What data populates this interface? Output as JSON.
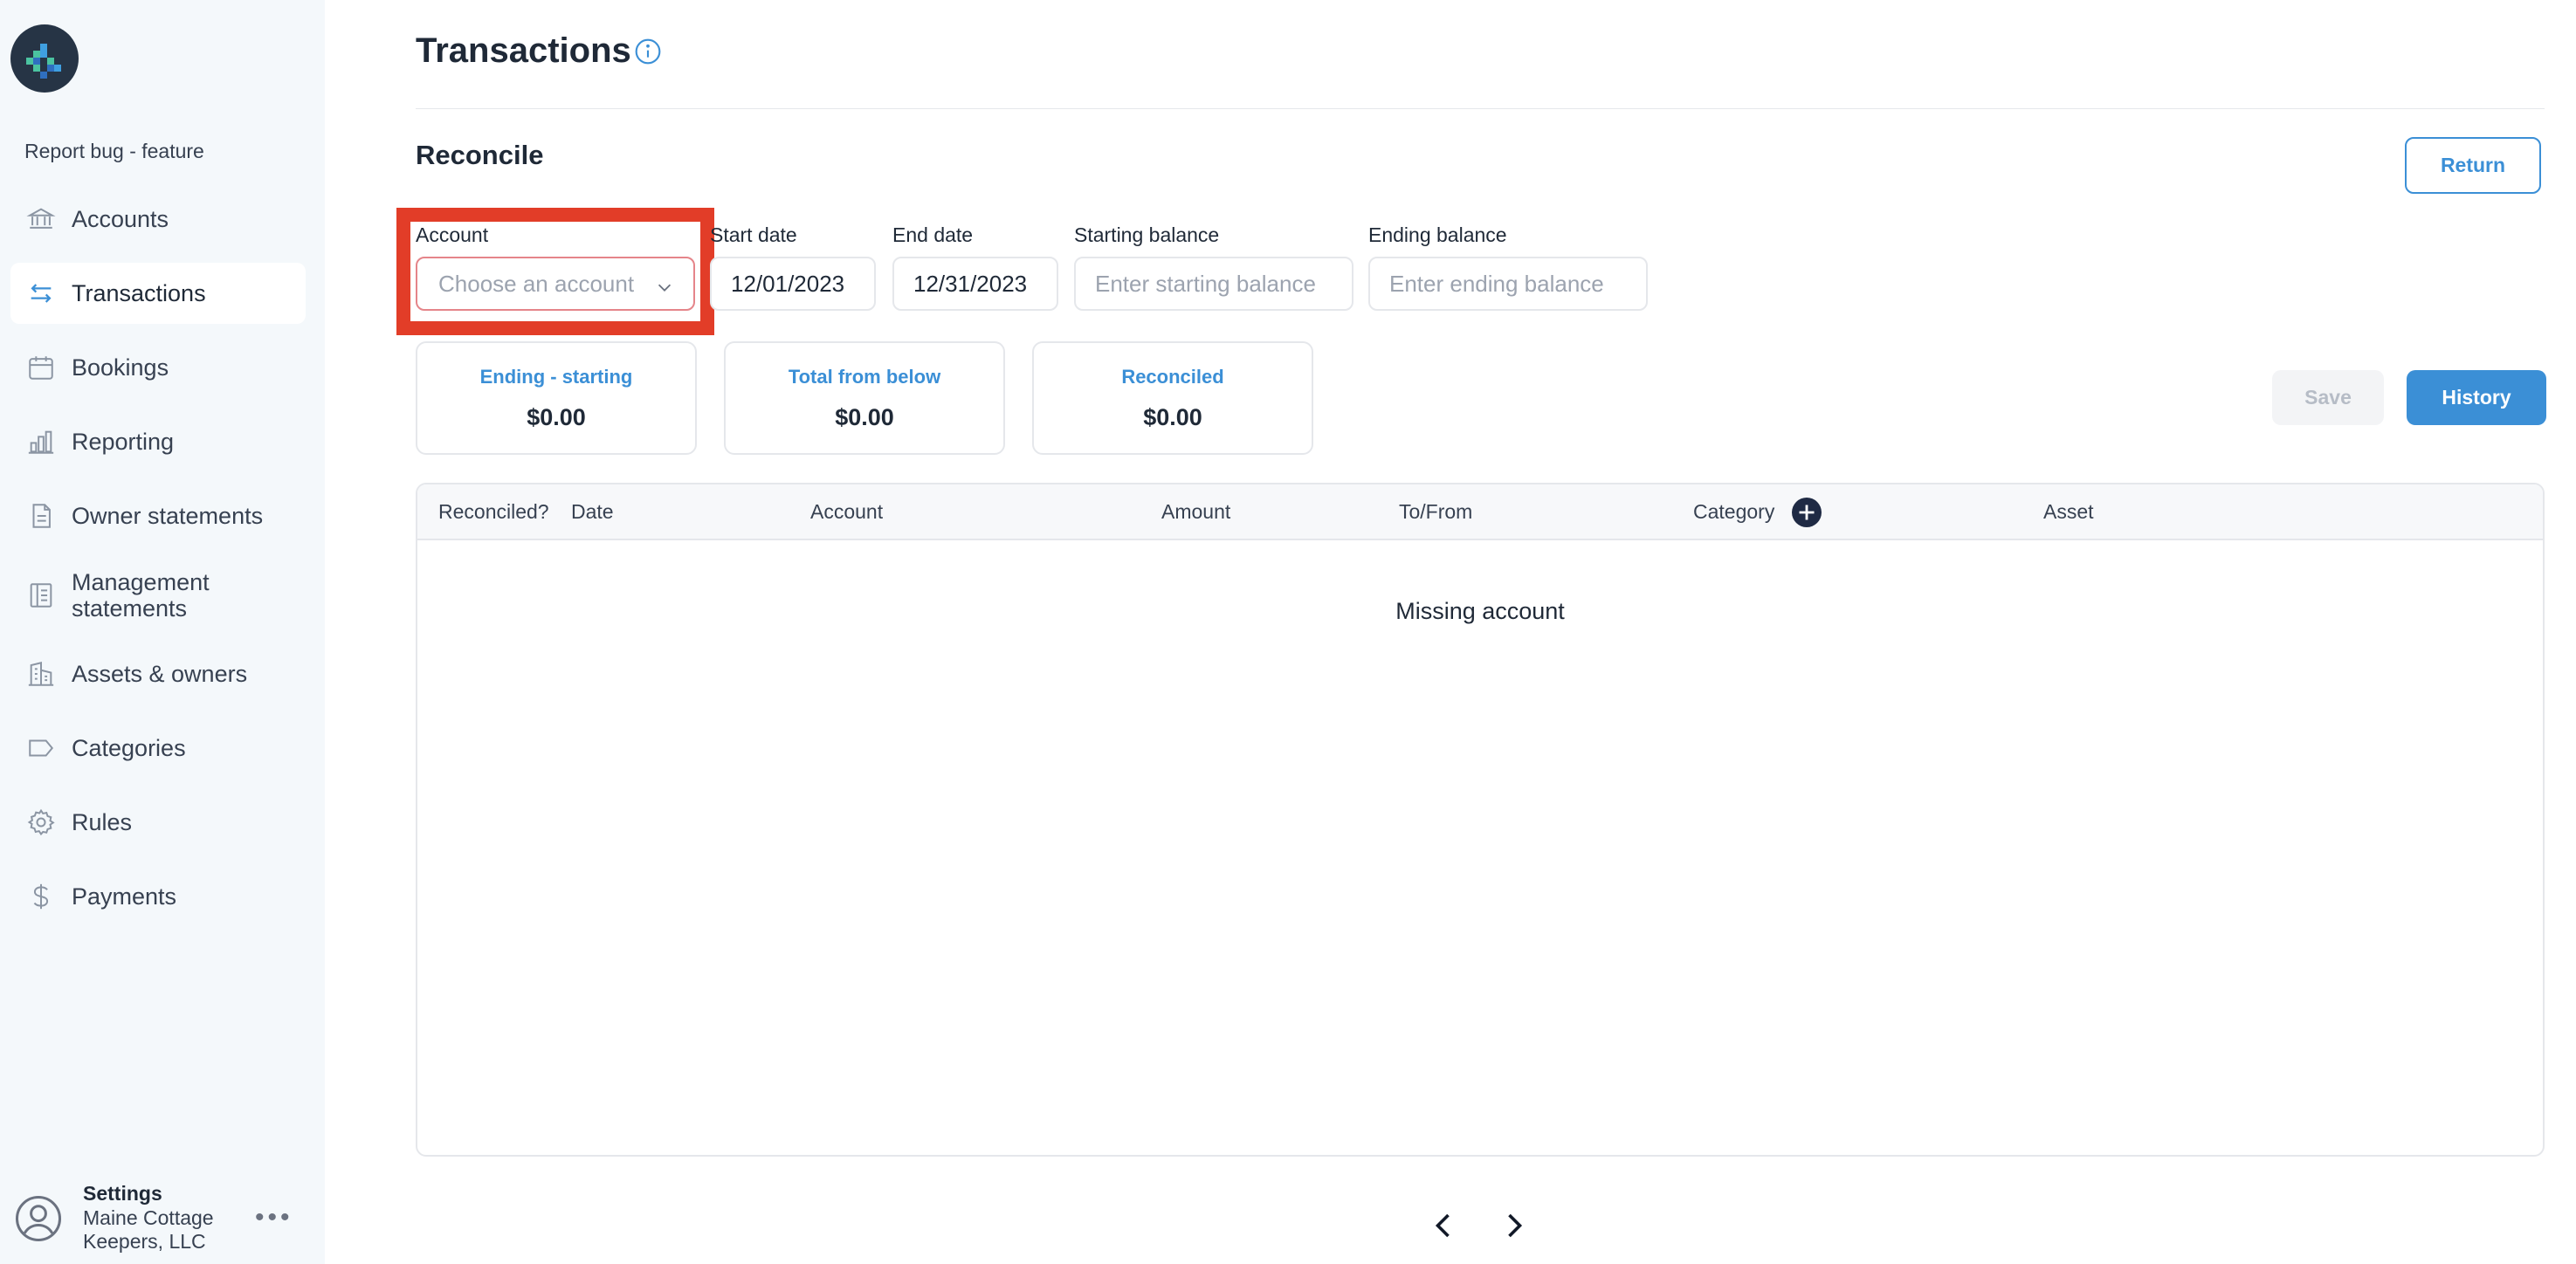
{
  "sidebar": {
    "report_bug": "Report bug - feature",
    "items": [
      {
        "label": "Accounts",
        "icon": "bank-icon",
        "active": false
      },
      {
        "label": "Transactions",
        "icon": "arrows-exchange-icon",
        "active": true
      },
      {
        "label": "Bookings",
        "icon": "calendar-icon",
        "active": false
      },
      {
        "label": "Reporting",
        "icon": "bar-chart-icon",
        "active": false
      },
      {
        "label": "Owner statements",
        "icon": "document-icon",
        "active": false
      },
      {
        "label": "Management statements",
        "icon": "statement-icon",
        "active": false
      },
      {
        "label": "Assets & owners",
        "icon": "building-icon",
        "active": false
      },
      {
        "label": "Categories",
        "icon": "tag-icon",
        "active": false
      },
      {
        "label": "Rules",
        "icon": "gear-icon",
        "active": false
      },
      {
        "label": "Payments",
        "icon": "dollar-icon",
        "active": false
      }
    ],
    "settings": {
      "title": "Settings",
      "org": "Maine Cottage Keepers, LLC",
      "more": "•••"
    }
  },
  "header": {
    "title": "Transactions",
    "section": "Reconcile",
    "return_label": "Return"
  },
  "form": {
    "account_label": "Account",
    "account_placeholder": "Choose an account",
    "start_date_label": "Start date",
    "start_date_value": "12/01/2023",
    "end_date_label": "End date",
    "end_date_value": "12/31/2023",
    "starting_balance_label": "Starting balance",
    "starting_balance_placeholder": "Enter starting balance",
    "ending_balance_label": "Ending balance",
    "ending_balance_placeholder": "Enter ending balance"
  },
  "summary": [
    {
      "label": "Ending - starting",
      "value": "$0.00"
    },
    {
      "label": "Total from below",
      "value": "$0.00"
    },
    {
      "label": "Reconciled",
      "value": "$0.00"
    }
  ],
  "actions": {
    "save_label": "Save",
    "history_label": "History"
  },
  "table": {
    "columns": [
      "Reconciled?",
      "Date",
      "Account",
      "Amount",
      "To/From",
      "Category",
      "Asset"
    ],
    "empty_message": "Missing account"
  },
  "colors": {
    "accent": "#3b8fd6",
    "highlight": "#e23d28",
    "sidebar_bg": "#f4f8fb"
  }
}
